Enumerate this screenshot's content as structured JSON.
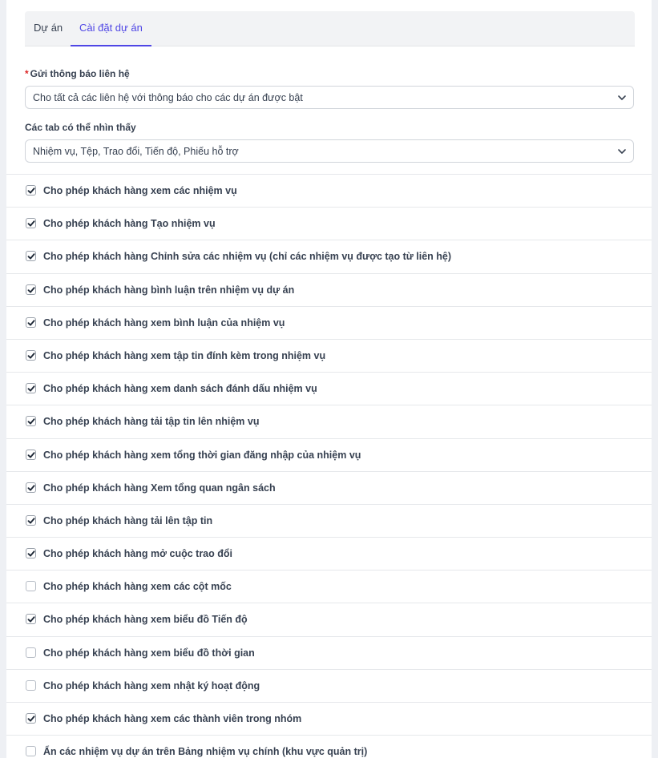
{
  "tabs": [
    {
      "label": "Dự án",
      "active": false
    },
    {
      "label": "Cài đặt dự án",
      "active": true
    }
  ],
  "send_notifications": {
    "required_mark": "*",
    "label": "Gửi thông báo liên hệ",
    "value": "Cho tất cả các liên hệ với thông báo cho các dự án được bật"
  },
  "visible_tabs": {
    "label": "Các tab có thể nhìn thấy",
    "value": "Nhiệm vụ, Tệp, Trao đổi, Tiến độ, Phiếu hỗ trợ"
  },
  "permissions": [
    {
      "label": "Cho phép khách hàng xem các nhiệm vụ",
      "checked": true
    },
    {
      "label": "Cho phép khách hàng Tạo nhiệm vụ",
      "checked": true
    },
    {
      "label": "Cho phép khách hàng Chỉnh sửa các nhiệm vụ (chỉ các nhiệm vụ được tạo từ liên hệ)",
      "checked": true
    },
    {
      "label": "Cho phép khách hàng bình luận trên nhiệm vụ dự án",
      "checked": true
    },
    {
      "label": "Cho phép khách hàng xem bình luận của nhiệm vụ",
      "checked": true
    },
    {
      "label": "Cho phép khách hàng xem tập tin đính kèm trong nhiệm vụ",
      "checked": true
    },
    {
      "label": "Cho phép khách hàng xem danh sách đánh dấu nhiệm vụ",
      "checked": true
    },
    {
      "label": "Cho phép khách hàng tải tập tin lên nhiệm vụ",
      "checked": true
    },
    {
      "label": "Cho phép khách hàng xem tổng thời gian đăng nhập của nhiệm vụ",
      "checked": true
    },
    {
      "label": "Cho phép khách hàng Xem tổng quan ngân sách",
      "checked": true
    },
    {
      "label": "Cho phép khách hàng tải lên tập tin",
      "checked": true
    },
    {
      "label": "Cho phép khách hàng mở cuộc trao đổi",
      "checked": true
    },
    {
      "label": "Cho phép khách hàng xem các cột mốc",
      "checked": false
    },
    {
      "label": "Cho phép khách hàng xem biểu đồ Tiến độ",
      "checked": true
    },
    {
      "label": "Cho phép khách hàng xem biểu đồ thời gian",
      "checked": false
    },
    {
      "label": "Cho phép khách hàng xem nhật ký hoạt động",
      "checked": false
    },
    {
      "label": "Cho phép khách hàng xem các thành viên trong nhóm",
      "checked": true
    },
    {
      "label": "Ẩn các nhiệm vụ dự án trên Bảng nhiệm vụ chính (khu vực quản trị)",
      "checked": false
    }
  ],
  "icons": {
    "checkbox_check": "check-icon",
    "select_arrow": "chevron-down-icon"
  },
  "colors": {
    "accent": "#4f46e5",
    "required": "#dc2626"
  }
}
